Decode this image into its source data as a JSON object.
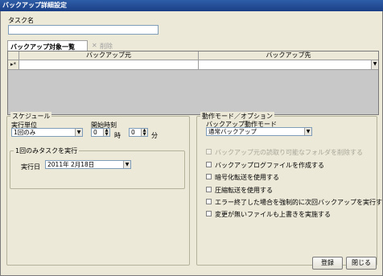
{
  "window": {
    "title": "バックアップ詳細設定"
  },
  "task": {
    "label": "タスク名",
    "value": ""
  },
  "targets": {
    "tab_label": "バックアップ対象一覧",
    "delete_label": "削除",
    "columns": [
      "バックアップ元",
      "バックアップ先"
    ],
    "new_row_marker": "*"
  },
  "schedule": {
    "title": "スケジュール",
    "unit_label": "実行単位",
    "unit_value": "1回のみ",
    "start_label": "開始時刻",
    "hour_value": "0",
    "hour_unit": "時",
    "minute_value": "0",
    "minute_unit": "分",
    "once_group_title": "1回のみタスクを実行",
    "date_label": "実行日",
    "date_value": "2011年 2月18日"
  },
  "options": {
    "title": "動作モード／オプション",
    "mode_label": "バックアップ動作モード",
    "mode_value": "通常バックアップ",
    "checks": [
      {
        "label": "バックアップ元の読取り可能なフォルダを削除する",
        "disabled": true
      },
      {
        "label": "バックアップログファイルを作成する",
        "disabled": false
      },
      {
        "label": "暗号化転送を使用する",
        "disabled": false
      },
      {
        "label": "圧縮転送を使用する",
        "disabled": false
      },
      {
        "label": "エラー終了した場合を強制的に次回バックアップを実行する",
        "disabled": false
      },
      {
        "label": "変更が無いファイルも上書きを実施する",
        "disabled": false
      }
    ]
  },
  "footer": {
    "register_label": "登録",
    "close_label": "閉じる"
  },
  "colors": {
    "titlebar": "#1a3f86",
    "face": "#ece9d8",
    "highlight": "#316ac5"
  }
}
